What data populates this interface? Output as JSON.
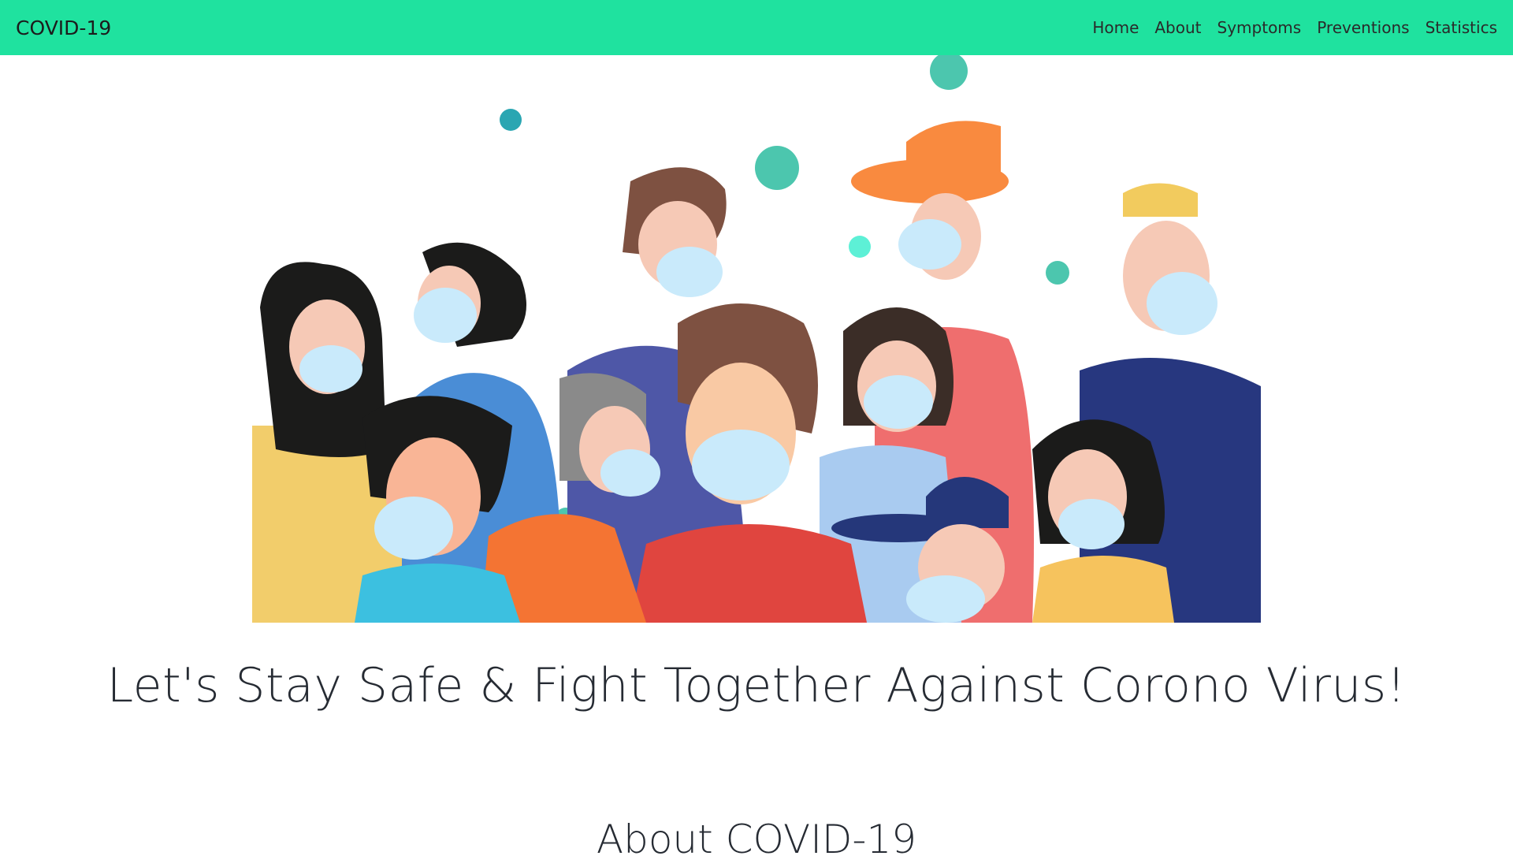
{
  "navbar": {
    "brand": "COVID-19",
    "background": "#1fe29f",
    "links": [
      {
        "label": "Home"
      },
      {
        "label": "About"
      },
      {
        "label": "Symptoms"
      },
      {
        "label": "Preventions"
      },
      {
        "label": "Statistics"
      }
    ]
  },
  "hero": {
    "image": "illustration-masked-people-and-virus-particles",
    "headline": "Let's Stay Safe & Fight Together Against Corono Virus!"
  },
  "about": {
    "title": "About COVID-19"
  }
}
